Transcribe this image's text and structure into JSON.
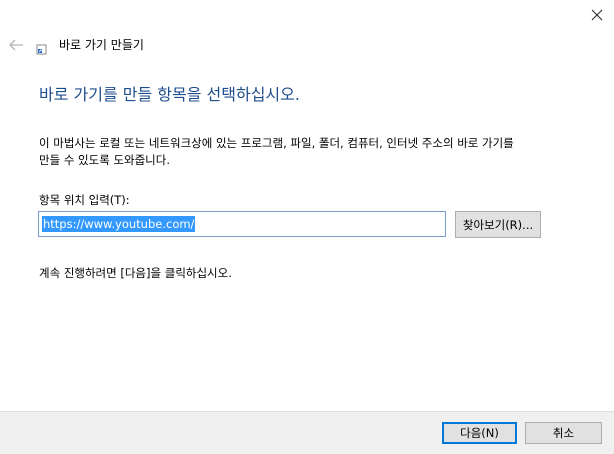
{
  "window": {
    "close_icon": "close-icon"
  },
  "header": {
    "back_icon": "back-arrow-icon",
    "wizard_icon": "shortcut-icon",
    "title": "바로 가기 만들기"
  },
  "main": {
    "heading": "바로 가기를 만들 항목을 선택하십시오.",
    "description_line1": "이 마법사는 로컬 또는 네트워크상에 있는 프로그램, 파일, 폴더, 컴퓨터, 인터넷 주소의 바로 가기를",
    "description_line2": "만들 수 있도록 도와줍니다.",
    "location_label": "항목 위치 입력(T):",
    "location_value": "https://www.youtube.com/",
    "browse_label": "찾아보기(R)...",
    "continue_text": "계속 진행하려면 [다음]을 클릭하십시오."
  },
  "footer": {
    "next_label": "다음(N)",
    "cancel_label": "취소"
  },
  "colors": {
    "heading": "#1f4e8c",
    "selection": "#3399ff",
    "default_button_border": "#0078d7",
    "footer_bg": "#f0f0f0"
  }
}
